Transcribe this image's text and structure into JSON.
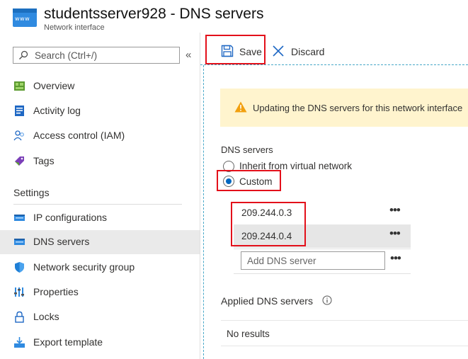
{
  "header": {
    "title": "studentsserver928 - DNS servers",
    "subtitle": "Network interface",
    "icon_text": "www"
  },
  "search": {
    "placeholder": "Search (Ctrl+/)",
    "value": ""
  },
  "collapse_glyph": "«",
  "nav": {
    "items": [
      {
        "label": "Overview",
        "icon": "overview-icon"
      },
      {
        "label": "Activity log",
        "icon": "activity-log-icon"
      },
      {
        "label": "Access control (IAM)",
        "icon": "access-control-icon"
      },
      {
        "label": "Tags",
        "icon": "tag-icon"
      }
    ],
    "settings_header": "Settings",
    "settings_items": [
      {
        "label": "IP configurations",
        "icon": "ip-config-icon"
      },
      {
        "label": "DNS servers",
        "icon": "dns-icon",
        "active": true
      },
      {
        "label": "Network security group",
        "icon": "shield-icon"
      },
      {
        "label": "Properties",
        "icon": "properties-icon"
      },
      {
        "label": "Locks",
        "icon": "lock-icon"
      },
      {
        "label": "Export template",
        "icon": "export-icon"
      }
    ]
  },
  "toolbar": {
    "save_label": "Save",
    "discard_label": "Discard"
  },
  "notice": {
    "message": "Updating the DNS servers for this network interface"
  },
  "dns": {
    "section_label": "DNS servers",
    "options": [
      {
        "label": "Inherit from virtual network",
        "selected": false
      },
      {
        "label": "Custom",
        "selected": true
      }
    ],
    "servers": [
      "209.244.0.3",
      "209.244.0.4"
    ],
    "more_glyph": "•••",
    "add_placeholder": "Add DNS server"
  },
  "applied": {
    "label": "Applied DNS servers",
    "empty_text": "No results"
  },
  "colors": {
    "accent": "#0067c0",
    "annotation": "#e3101a",
    "warning_bg": "#fff4ce",
    "warning_icon": "#f2a00f"
  }
}
